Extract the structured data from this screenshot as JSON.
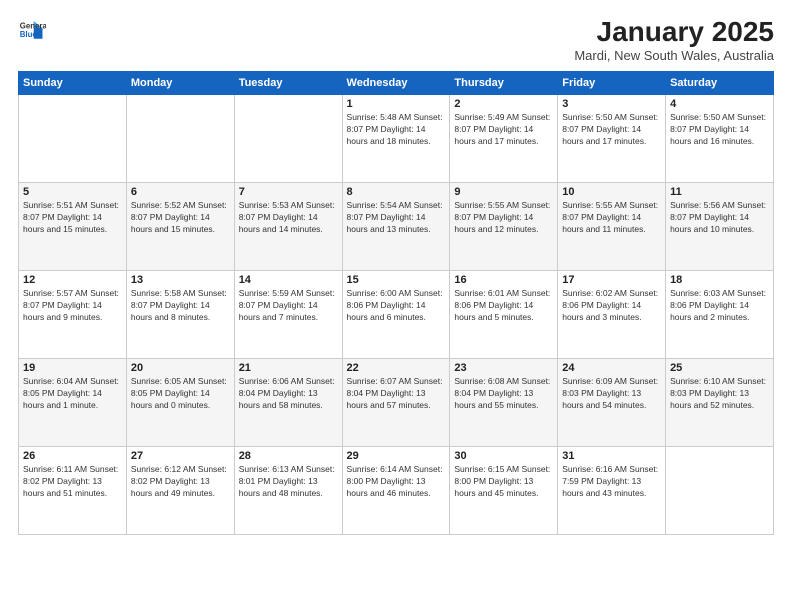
{
  "header": {
    "logo_line1": "General",
    "logo_line2": "Blue",
    "month": "January 2025",
    "location": "Mardi, New South Wales, Australia"
  },
  "days_of_week": [
    "Sunday",
    "Monday",
    "Tuesday",
    "Wednesday",
    "Thursday",
    "Friday",
    "Saturday"
  ],
  "weeks": [
    [
      {
        "day": "",
        "info": ""
      },
      {
        "day": "",
        "info": ""
      },
      {
        "day": "",
        "info": ""
      },
      {
        "day": "1",
        "info": "Sunrise: 5:48 AM\nSunset: 8:07 PM\nDaylight: 14 hours\nand 18 minutes."
      },
      {
        "day": "2",
        "info": "Sunrise: 5:49 AM\nSunset: 8:07 PM\nDaylight: 14 hours\nand 17 minutes."
      },
      {
        "day": "3",
        "info": "Sunrise: 5:50 AM\nSunset: 8:07 PM\nDaylight: 14 hours\nand 17 minutes."
      },
      {
        "day": "4",
        "info": "Sunrise: 5:50 AM\nSunset: 8:07 PM\nDaylight: 14 hours\nand 16 minutes."
      }
    ],
    [
      {
        "day": "5",
        "info": "Sunrise: 5:51 AM\nSunset: 8:07 PM\nDaylight: 14 hours\nand 15 minutes."
      },
      {
        "day": "6",
        "info": "Sunrise: 5:52 AM\nSunset: 8:07 PM\nDaylight: 14 hours\nand 15 minutes."
      },
      {
        "day": "7",
        "info": "Sunrise: 5:53 AM\nSunset: 8:07 PM\nDaylight: 14 hours\nand 14 minutes."
      },
      {
        "day": "8",
        "info": "Sunrise: 5:54 AM\nSunset: 8:07 PM\nDaylight: 14 hours\nand 13 minutes."
      },
      {
        "day": "9",
        "info": "Sunrise: 5:55 AM\nSunset: 8:07 PM\nDaylight: 14 hours\nand 12 minutes."
      },
      {
        "day": "10",
        "info": "Sunrise: 5:55 AM\nSunset: 8:07 PM\nDaylight: 14 hours\nand 11 minutes."
      },
      {
        "day": "11",
        "info": "Sunrise: 5:56 AM\nSunset: 8:07 PM\nDaylight: 14 hours\nand 10 minutes."
      }
    ],
    [
      {
        "day": "12",
        "info": "Sunrise: 5:57 AM\nSunset: 8:07 PM\nDaylight: 14 hours\nand 9 minutes."
      },
      {
        "day": "13",
        "info": "Sunrise: 5:58 AM\nSunset: 8:07 PM\nDaylight: 14 hours\nand 8 minutes."
      },
      {
        "day": "14",
        "info": "Sunrise: 5:59 AM\nSunset: 8:07 PM\nDaylight: 14 hours\nand 7 minutes."
      },
      {
        "day": "15",
        "info": "Sunrise: 6:00 AM\nSunset: 8:06 PM\nDaylight: 14 hours\nand 6 minutes."
      },
      {
        "day": "16",
        "info": "Sunrise: 6:01 AM\nSunset: 8:06 PM\nDaylight: 14 hours\nand 5 minutes."
      },
      {
        "day": "17",
        "info": "Sunrise: 6:02 AM\nSunset: 8:06 PM\nDaylight: 14 hours\nand 3 minutes."
      },
      {
        "day": "18",
        "info": "Sunrise: 6:03 AM\nSunset: 8:06 PM\nDaylight: 14 hours\nand 2 minutes."
      }
    ],
    [
      {
        "day": "19",
        "info": "Sunrise: 6:04 AM\nSunset: 8:05 PM\nDaylight: 14 hours\nand 1 minute."
      },
      {
        "day": "20",
        "info": "Sunrise: 6:05 AM\nSunset: 8:05 PM\nDaylight: 14 hours\nand 0 minutes."
      },
      {
        "day": "21",
        "info": "Sunrise: 6:06 AM\nSunset: 8:04 PM\nDaylight: 13 hours\nand 58 minutes."
      },
      {
        "day": "22",
        "info": "Sunrise: 6:07 AM\nSunset: 8:04 PM\nDaylight: 13 hours\nand 57 minutes."
      },
      {
        "day": "23",
        "info": "Sunrise: 6:08 AM\nSunset: 8:04 PM\nDaylight: 13 hours\nand 55 minutes."
      },
      {
        "day": "24",
        "info": "Sunrise: 6:09 AM\nSunset: 8:03 PM\nDaylight: 13 hours\nand 54 minutes."
      },
      {
        "day": "25",
        "info": "Sunrise: 6:10 AM\nSunset: 8:03 PM\nDaylight: 13 hours\nand 52 minutes."
      }
    ],
    [
      {
        "day": "26",
        "info": "Sunrise: 6:11 AM\nSunset: 8:02 PM\nDaylight: 13 hours\nand 51 minutes."
      },
      {
        "day": "27",
        "info": "Sunrise: 6:12 AM\nSunset: 8:02 PM\nDaylight: 13 hours\nand 49 minutes."
      },
      {
        "day": "28",
        "info": "Sunrise: 6:13 AM\nSunset: 8:01 PM\nDaylight: 13 hours\nand 48 minutes."
      },
      {
        "day": "29",
        "info": "Sunrise: 6:14 AM\nSunset: 8:00 PM\nDaylight: 13 hours\nand 46 minutes."
      },
      {
        "day": "30",
        "info": "Sunrise: 6:15 AM\nSunset: 8:00 PM\nDaylight: 13 hours\nand 45 minutes."
      },
      {
        "day": "31",
        "info": "Sunrise: 6:16 AM\nSunset: 7:59 PM\nDaylight: 13 hours\nand 43 minutes."
      },
      {
        "day": "",
        "info": ""
      }
    ]
  ]
}
